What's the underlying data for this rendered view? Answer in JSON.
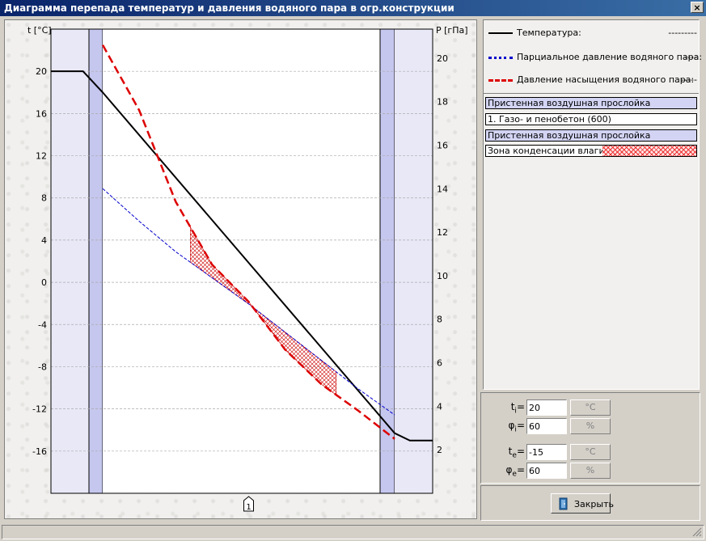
{
  "window": {
    "title": "Диаграмма перепада температур и давления водяного пара в огр.конструкции",
    "close_glyph": "×"
  },
  "chart": {
    "left_axis_label": "t [°C]",
    "right_axis_label": "P [гПа]",
    "layer_marker": "1"
  },
  "chart_data": {
    "type": "line",
    "y_left": {
      "label": "t [°C]",
      "range": [
        -20,
        24
      ],
      "ticks": [
        -16,
        -12,
        -8,
        -4,
        0,
        4,
        8,
        12,
        16,
        20
      ]
    },
    "y_right": {
      "label": "P [гПа]",
      "range": [
        0,
        21.33
      ],
      "ticks": [
        2,
        4,
        6,
        8,
        10,
        12,
        14,
        16,
        18,
        20
      ]
    },
    "grid": true,
    "section_x": {
      "left_start": 0,
      "wall_inner": 1,
      "wall_outer": 2,
      "right_end": 3
    },
    "layer_marker_x": 1.5,
    "series": [
      {
        "name": "Температура",
        "axis": "left",
        "color": "#000000",
        "style": "solid",
        "points": [
          [
            0,
            20
          ],
          [
            0.62,
            20
          ],
          [
            1,
            18
          ],
          [
            2,
            -14.3
          ],
          [
            2.4,
            -15
          ],
          [
            3,
            -15
          ]
        ]
      },
      {
        "name": "Парциальное давление водяного пара",
        "axis": "right",
        "color": "#0000cc",
        "style": "dotted",
        "points": [
          [
            1,
            14.0
          ],
          [
            1.125,
            12.5
          ],
          [
            1.25,
            11.1
          ],
          [
            1.375,
            9.9
          ],
          [
            1.5,
            8.7
          ],
          [
            1.625,
            7.4
          ],
          [
            1.75,
            6.1
          ],
          [
            1.875,
            4.8
          ],
          [
            2,
            3.6
          ]
        ]
      },
      {
        "name": "Давление насыщения водяного пара",
        "axis": "right",
        "color": "#dd0000",
        "style": "dashed",
        "points": [
          [
            1,
            20.6
          ],
          [
            1.125,
            17.6
          ],
          [
            1.25,
            13.4
          ],
          [
            1.375,
            10.5
          ],
          [
            1.5,
            8.8
          ],
          [
            1.625,
            6.6
          ],
          [
            1.75,
            5.0
          ],
          [
            1.875,
            3.8
          ],
          [
            2,
            2.5
          ]
        ]
      }
    ],
    "condensation_zone": {
      "x_range": [
        1.3,
        1.8
      ]
    }
  },
  "legend": {
    "items": [
      {
        "label": "Температура:",
        "value": "---------",
        "color": "#000000"
      },
      {
        "label": "Парциальное давление водяного пара:",
        "value": "----",
        "color": "#0000cc"
      },
      {
        "label": "Давление насыщения водяного пара:",
        "value": "-----",
        "color": "#dd0000"
      }
    ]
  },
  "layers": [
    {
      "label": "Пристенная воздушная прослойка",
      "kind": "air"
    },
    {
      "label": "1. Газо- и пенобетон (600)",
      "kind": "solid"
    },
    {
      "label": "Пристенная воздушная прослойка",
      "kind": "air"
    },
    {
      "label": "Зона конденсации влаги ->",
      "kind": "condensation"
    }
  ],
  "params": [
    {
      "symbol": "t",
      "sub": "i",
      "value": "20",
      "unit": "°C"
    },
    {
      "symbol": "φ",
      "sub": "i",
      "value": "60",
      "unit": "%"
    },
    {
      "symbol": "t",
      "sub": "e",
      "value": "-15",
      "unit": "°C"
    },
    {
      "symbol": "φ",
      "sub": "e",
      "value": "60",
      "unit": "%"
    }
  ],
  "buttons": {
    "close_label": "Закрыть"
  }
}
